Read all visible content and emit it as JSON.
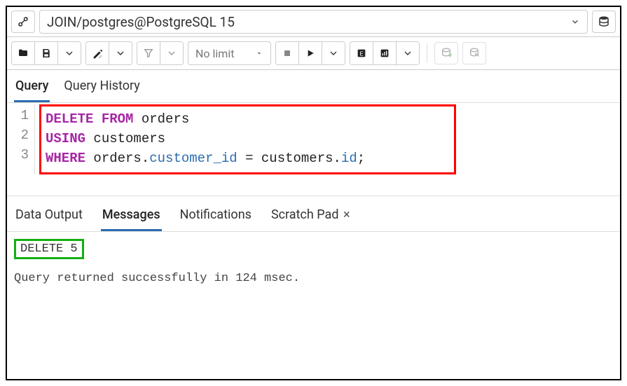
{
  "connection": {
    "label": "JOIN/postgres@PostgreSQL 15"
  },
  "toolbar": {
    "limit_label": "No limit"
  },
  "query_tabs": {
    "query": "Query",
    "history": "Query History"
  },
  "editor": {
    "lines": [
      "1",
      "2",
      "3"
    ],
    "line1_kw1": "DELETE",
    "line1_kw2": "FROM",
    "line1_tbl": "orders",
    "line2_kw": "USING",
    "line2_tbl": "customers",
    "line3_kw": "WHERE",
    "line3_left_tbl": "orders",
    "line3_left_col": "customer_id",
    "line3_eq": " = ",
    "line3_right_tbl": "customers",
    "line3_right_col": "id",
    "line3_semi": ";"
  },
  "result_tabs": {
    "data_output": "Data Output",
    "messages": "Messages",
    "notifications": "Notifications",
    "scratch_pad": "Scratch Pad"
  },
  "messages": {
    "delete_result": "DELETE 5",
    "status": "Query returned successfully in 124 msec."
  }
}
